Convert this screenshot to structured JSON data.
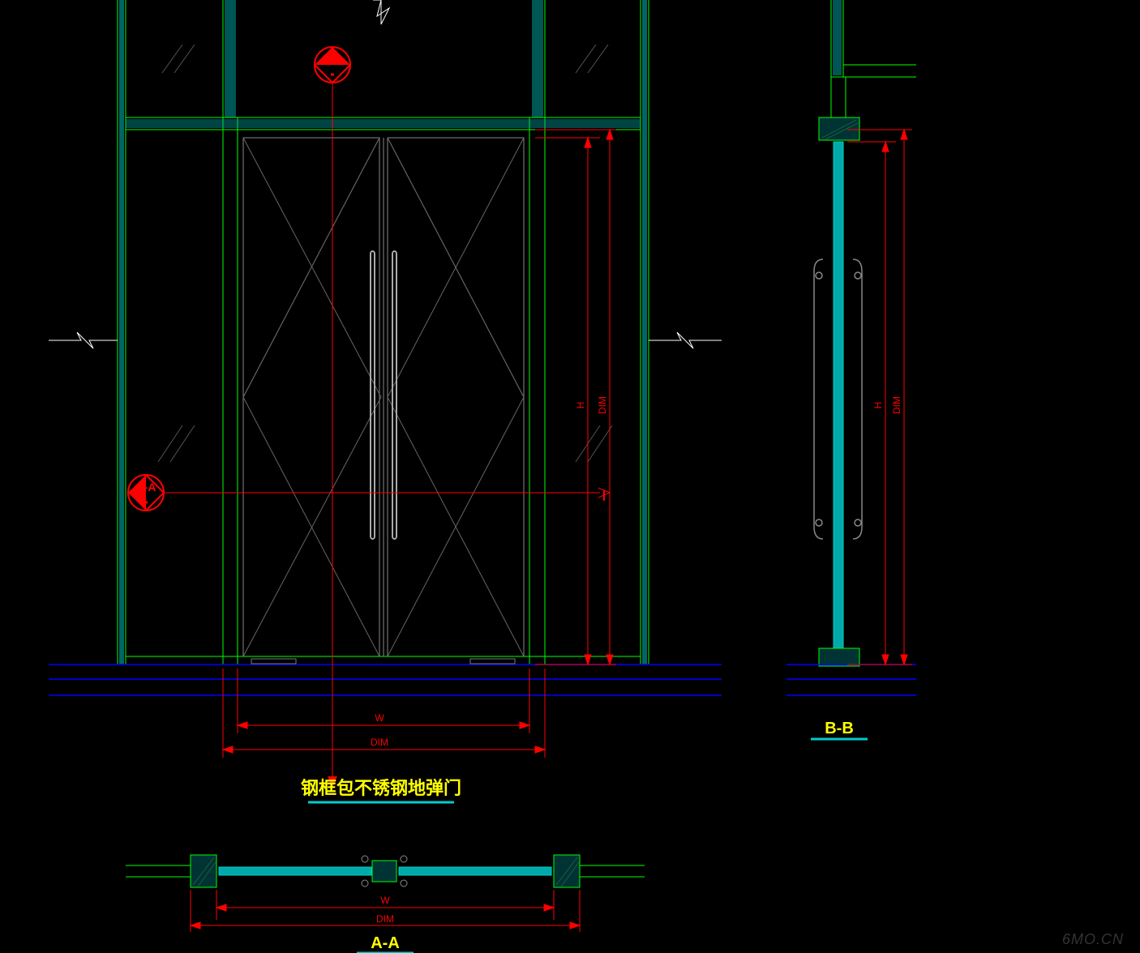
{
  "labels": {
    "section_bb_marker": "B-B",
    "section_aa_marker": "A-A",
    "main_title": "钢框包不锈钢地弹门",
    "section_bb_title": "B-B",
    "section_aa_title": "A-A",
    "dim_w": "W",
    "dim_dim": "DIM",
    "dim_h": "H",
    "watermark": "6MO.CN"
  }
}
